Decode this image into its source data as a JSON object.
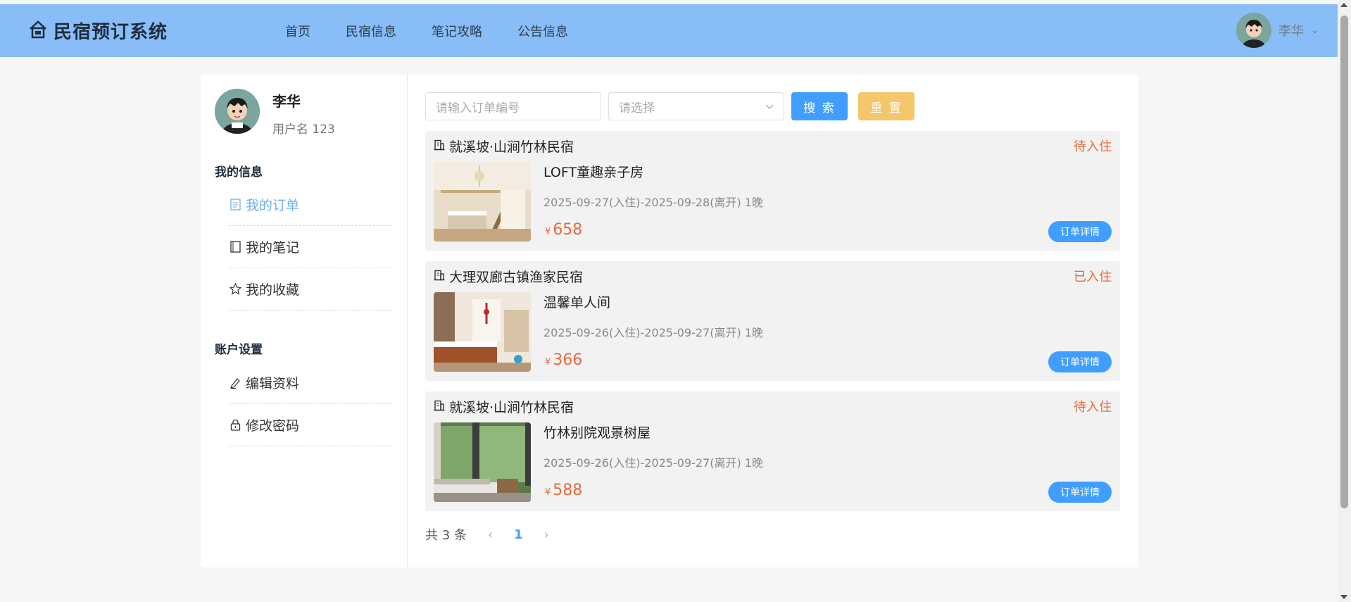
{
  "header": {
    "app_title": "民宿预订系统",
    "nav": [
      "首页",
      "民宿信息",
      "笔记攻略",
      "公告信息"
    ],
    "user_name": "李华"
  },
  "sidebar": {
    "name": "李华",
    "username": "用户名 123",
    "section_info": "我的信息",
    "info_items": [
      {
        "label": "我的订单",
        "icon": "order-icon",
        "active": true
      },
      {
        "label": "我的笔记",
        "icon": "notebook-icon",
        "active": false
      },
      {
        "label": "我的收藏",
        "icon": "star-icon",
        "active": false
      }
    ],
    "section_account": "账户设置",
    "account_items": [
      {
        "label": "编辑资料",
        "icon": "edit-icon"
      },
      {
        "label": "修改密码",
        "icon": "lock-icon"
      }
    ]
  },
  "search": {
    "order_placeholder": "请输入订单编号",
    "select_placeholder": "请选择",
    "search_label": "搜 索",
    "reset_label": "重 置"
  },
  "orders": [
    {
      "homestay": "就溪坡·山涧竹林民宿",
      "status": "待入住",
      "room": "LOFT童趣亲子房",
      "dates": "2025-09-27(入住)-2025-09-28(离开) 1晚",
      "currency": "¥",
      "price": "658",
      "detail": "订单详情"
    },
    {
      "homestay": "大理双廊古镇渔家民宿",
      "status": "已入住",
      "room": "温馨单人间",
      "dates": "2025-09-26(入住)-2025-09-27(离开) 1晚",
      "currency": "¥",
      "price": "366",
      "detail": "订单详情"
    },
    {
      "homestay": "就溪坡·山涧竹林民宿",
      "status": "待入住",
      "room": "竹林别院观景树屋",
      "dates": "2025-09-26(入住)-2025-09-27(离开) 1晚",
      "currency": "¥",
      "price": "588",
      "detail": "订单详情"
    }
  ],
  "pagination": {
    "total": "共 3 条",
    "current": "1"
  },
  "colors": {
    "header": "#89bdf7",
    "primary": "#409eff",
    "reset": "#f5c76a",
    "status": "#e6693c",
    "active_menu": "#6db0f0"
  }
}
